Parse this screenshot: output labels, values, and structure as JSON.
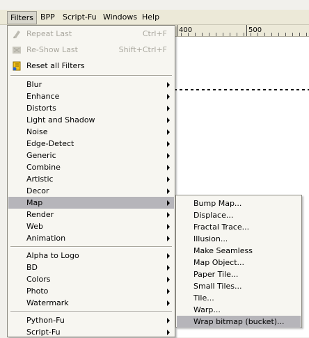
{
  "menubar": {
    "items": [
      {
        "label": "Filters"
      },
      {
        "label": "BPP"
      },
      {
        "label": "Script-Fu"
      },
      {
        "label": "Windows"
      },
      {
        "label": "Help"
      }
    ]
  },
  "ruler": {
    "tick_400": "400",
    "tick_500": "500"
  },
  "filters_menu": {
    "top_items": [
      {
        "label": "Repeat Last",
        "accel": "Ctrl+F",
        "icon": "repeat-icon"
      },
      {
        "label": "Re-Show Last",
        "accel": "Shift+Ctrl+F",
        "icon": "reshow-icon"
      },
      {
        "label": "Reset all Filters",
        "icon": "reset-icon"
      }
    ],
    "group1": [
      "Blur",
      "Enhance",
      "Distorts",
      "Light and Shadow",
      "Noise",
      "Edge-Detect",
      "Generic",
      "Combine",
      "Artistic",
      "Decor",
      "Map",
      "Render",
      "Web",
      "Animation"
    ],
    "group2": [
      "Alpha to Logo",
      "BD",
      "Colors",
      "Photo",
      "Watermark"
    ],
    "group3": [
      "Python-Fu",
      "Script-Fu"
    ]
  },
  "map_submenu": {
    "items": [
      "Bump Map...",
      "Displace...",
      "Fractal Trace...",
      "Illusion...",
      "Make Seamless",
      "Map Object...",
      "Paper Tile...",
      "Small Tiles...",
      "Tile...",
      "Warp...",
      "Wrap bitmap (bucket)..."
    ]
  },
  "colors": {
    "highlight": "#b6b5ba",
    "menubar": "#ece9d8",
    "menu_bg": "#f7f6f1"
  }
}
